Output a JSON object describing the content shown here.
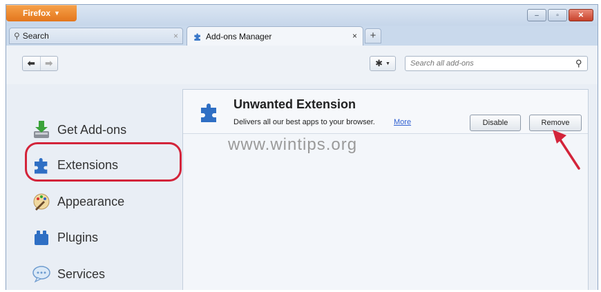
{
  "titlebar": {
    "app_menu_label": "Firefox",
    "minimize_symbol": "–",
    "restore_symbol": "▫",
    "close_symbol": "✕"
  },
  "tabs": {
    "search_tab_label": "Search",
    "active_tab_label": "Add-ons Manager",
    "tab_close_symbol": "×",
    "new_tab_symbol": "+"
  },
  "toolbar": {
    "back_symbol": "⬅",
    "forward_symbol": "➡",
    "gear_symbol": "✱",
    "search_placeholder": "Search all add-ons"
  },
  "sidebar": {
    "items": [
      {
        "label": "Get Add-ons",
        "icon": "download-icon"
      },
      {
        "label": "Extensions",
        "icon": "puzzle-icon"
      },
      {
        "label": "Appearance",
        "icon": "paintbrush-icon"
      },
      {
        "label": "Plugins",
        "icon": "plugin-icon"
      },
      {
        "label": "Services",
        "icon": "speech-bubble-icon"
      }
    ]
  },
  "addon": {
    "name": "Unwanted Extension",
    "description": "Delivers all our best apps to your browser.",
    "more_link": "More",
    "disable_label": "Disable",
    "remove_label": "Remove"
  },
  "watermark": "www.wintips.org",
  "colors": {
    "accent_orange": "#e3761d",
    "highlight_red": "#d3243a",
    "link_blue": "#2e5fd1",
    "window_blue": "#c9d9ec"
  }
}
